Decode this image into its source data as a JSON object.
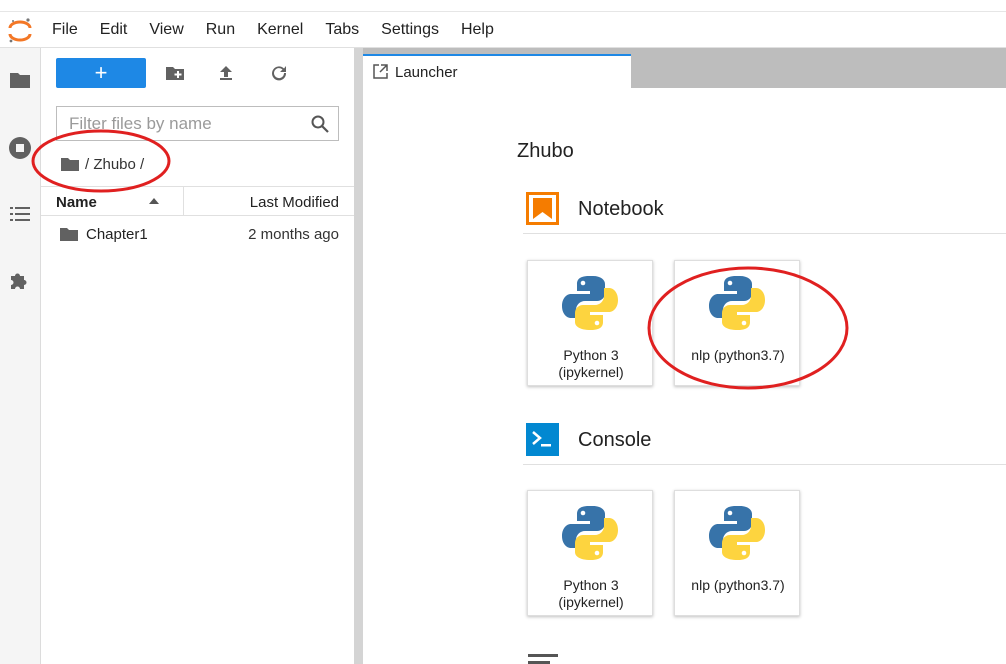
{
  "menubar": {
    "items": [
      "File",
      "Edit",
      "View",
      "Run",
      "Kernel",
      "Tabs",
      "Settings",
      "Help"
    ]
  },
  "sidebar": {
    "icons": [
      "folder-icon",
      "running-icon",
      "toc-icon",
      "extension-icon"
    ]
  },
  "filebrowser": {
    "new_label": "+",
    "filter_placeholder": "Filter files by name",
    "breadcrumb": "/ Zhubo /",
    "columns": {
      "name": "Name",
      "modified": "Last Modified"
    },
    "files": [
      {
        "name": "Chapter1",
        "modified": "2 months ago",
        "type": "folder"
      }
    ]
  },
  "tabs": [
    {
      "label": "Launcher"
    }
  ],
  "launcher": {
    "title": "Zhubo",
    "sections": [
      {
        "label": "Notebook",
        "kernels": [
          {
            "label": "Python 3 (ipykernel)"
          },
          {
            "label": "nlp (python3.7)"
          }
        ]
      },
      {
        "label": "Console",
        "kernels": [
          {
            "label": "Python 3 (ipykernel)"
          },
          {
            "label": "nlp (python3.7)"
          }
        ]
      }
    ]
  },
  "colors": {
    "accent": "#1e88e5",
    "notebook_orange": "#f57c00",
    "annotation_red": "#e02020"
  }
}
